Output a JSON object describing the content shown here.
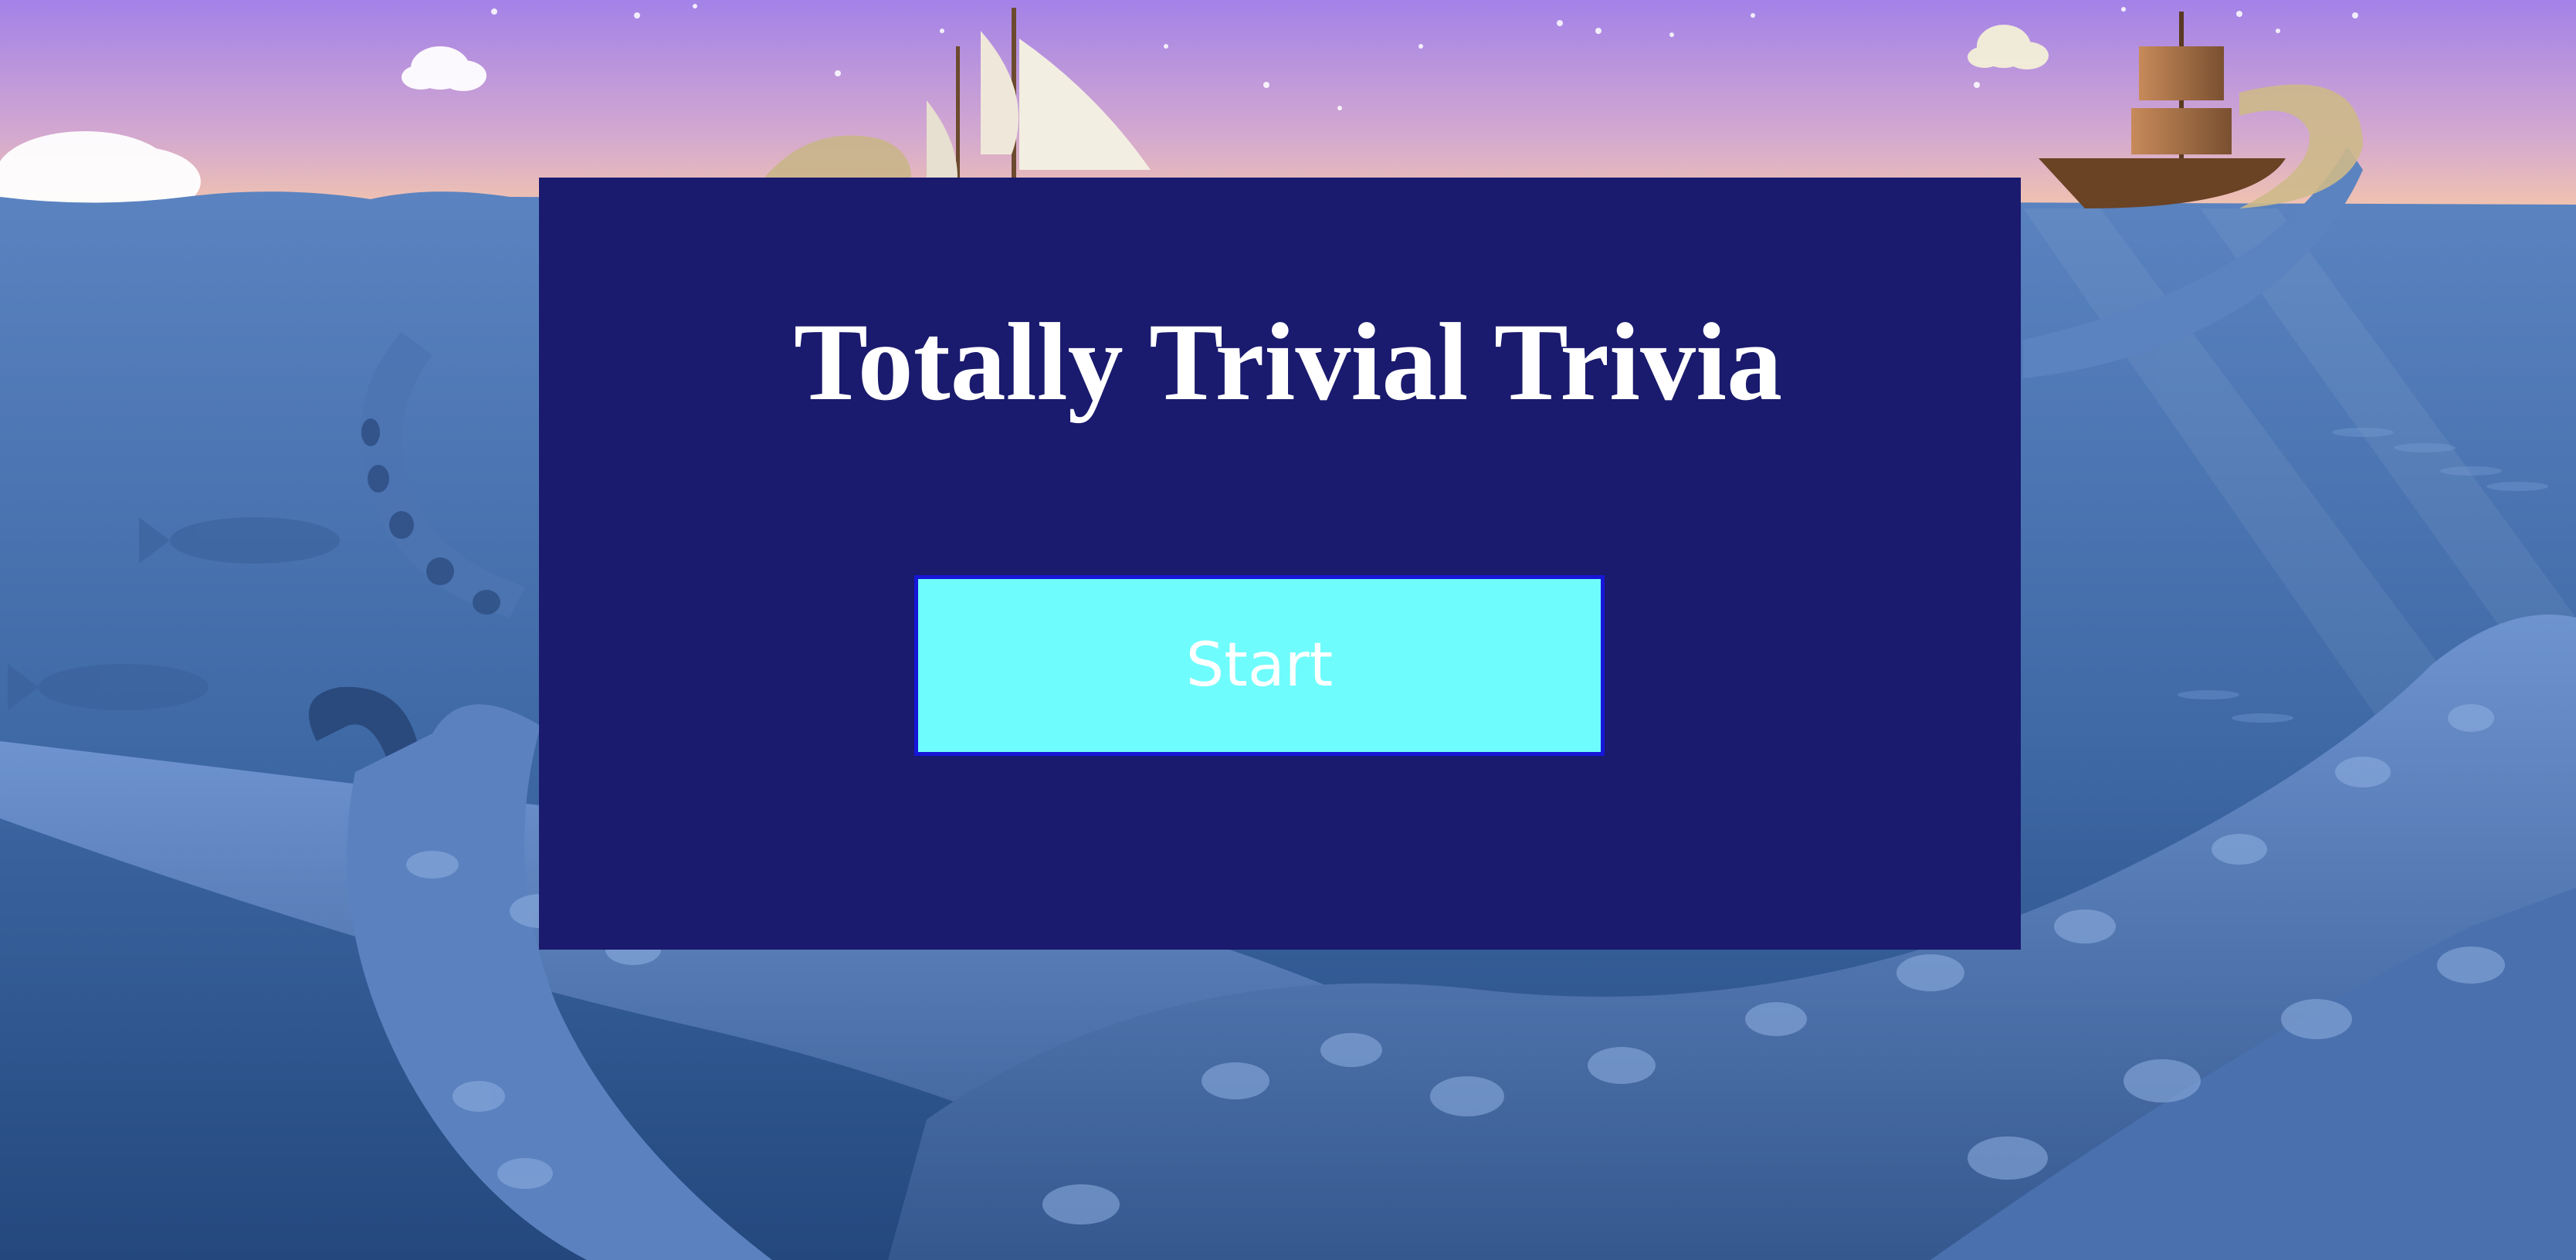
{
  "app": {
    "title": "Totally Trivial Trivia"
  },
  "actions": {
    "start_label": "Start"
  },
  "scene": {
    "sky_top_color": "#a382e8",
    "sky_horizon_color": "#f7c9a8",
    "sea_color": "#3f6aa6",
    "card_color": "#1a1a6e",
    "button_color": "#6ffcfc",
    "button_border_color": "#1616d8",
    "icons": [
      "cloud-icon",
      "sailing-ship-icon",
      "galleon-icon",
      "tentacle-icon",
      "fish-icon"
    ]
  }
}
